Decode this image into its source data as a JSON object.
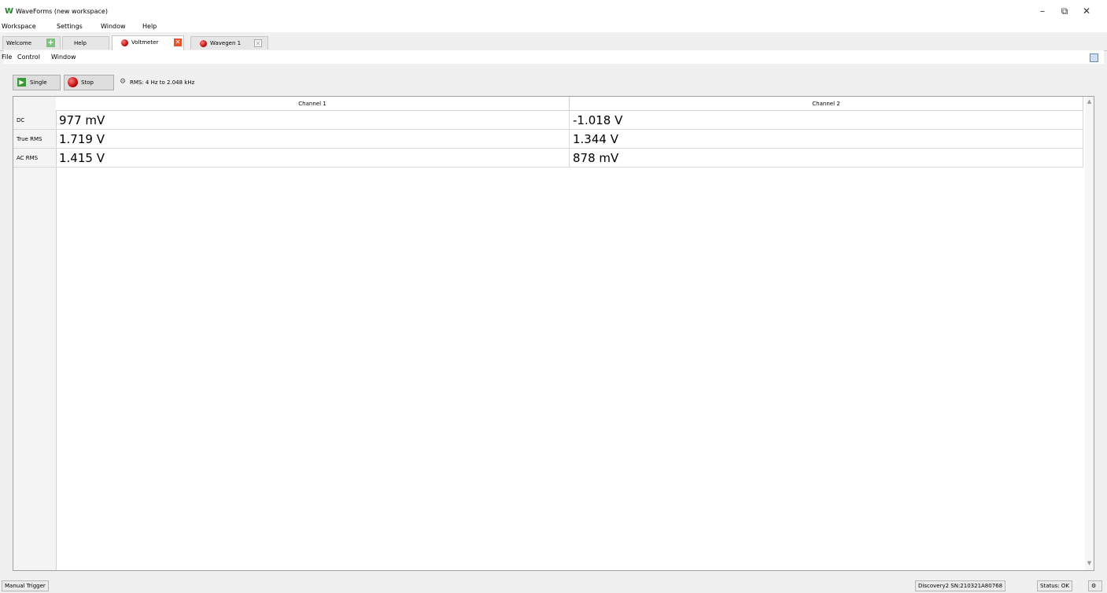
{
  "window": {
    "title": "WaveForms  (new workspace)",
    "logo_glyph": "W",
    "minimize": "–",
    "restore": "⧉",
    "close": "✕"
  },
  "main_menu": [
    "Workspace",
    "Settings",
    "Window",
    "Help"
  ],
  "tabs": [
    {
      "label": "Welcome",
      "icon": "plus-icon"
    },
    {
      "label": "Help"
    },
    {
      "label": "Voltmeter",
      "icon": "red-dot-icon",
      "active": true
    },
    {
      "label": "Wavegen 1",
      "icon": "red-dot-icon"
    }
  ],
  "instrument_menu": [
    "File",
    "Control",
    "Window"
  ],
  "toolbar": {
    "single_label": "Single",
    "stop_label": "Stop",
    "rms_info": "RMS: 4 Hz to 2.048 kHz"
  },
  "table": {
    "columns": [
      "Channel 1",
      "Channel 2"
    ],
    "rows": [
      {
        "label": "DC",
        "values": [
          "977 mV",
          "-1.018 V"
        ]
      },
      {
        "label": "True RMS",
        "values": [
          "1.719 V",
          "1.344 V"
        ]
      },
      {
        "label": "AC RMS",
        "values": [
          "1.415 V",
          "878 mV"
        ]
      }
    ]
  },
  "status": {
    "trigger": "Manual Trigger",
    "device": "Discovery2 SN:210321A80768",
    "state": "Status: OK"
  },
  "colors": {
    "accent_green": "#3a9a3a",
    "stop_red": "#b40000",
    "close_orange": "#e8542c"
  }
}
